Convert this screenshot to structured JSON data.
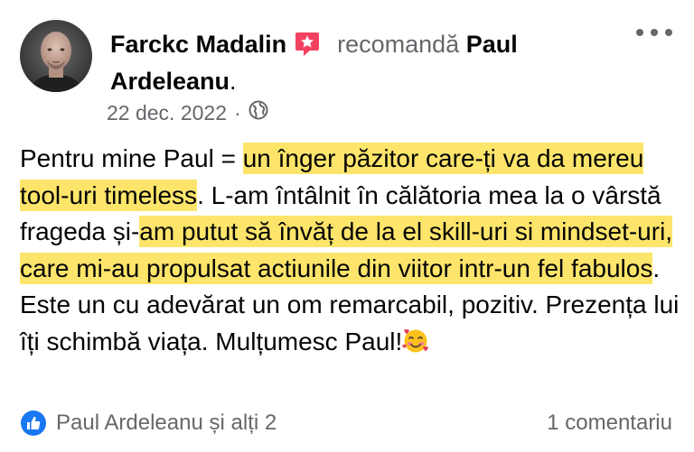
{
  "post": {
    "author": "Farckc Madalin",
    "action": "recomandă",
    "recommended_first": "Paul",
    "recommended_last": "Ardeleanu",
    "period": ".",
    "date": "22 dec. 2022",
    "separator": "·",
    "audience_icon": "globe-icon",
    "badge_icon": "recommend-star-icon",
    "more_icon": "more-options-icon"
  },
  "body": {
    "s1": "Pentru mine Paul = ",
    "h1": "un înger păzitor care-ți va da mereu tool-uri timeless",
    "s2": ". L-am întâlnit în călătoria mea la o vârstă frageda și-",
    "h2": "am putut să învăț de la el skill-uri si mindset-uri, care mi-au propulsat actiunile din viitor intr-un fel fabulos",
    "s3": ". Este un cu adevărat un om remarcabil, pozitiv. Prezența lui îți schimbă viața. Mulțumesc Paul!",
    "emoji": "smiling-face-with-hearts-emoji"
  },
  "footer": {
    "reaction_icon": "like-icon",
    "reactions": "Paul Ardeleanu și alți 2",
    "comments": "1 comentariu"
  },
  "colors": {
    "highlight": "#fde56b",
    "badge": "#f3425f",
    "like": "#1877f2",
    "secondary_text": "#65676b"
  }
}
